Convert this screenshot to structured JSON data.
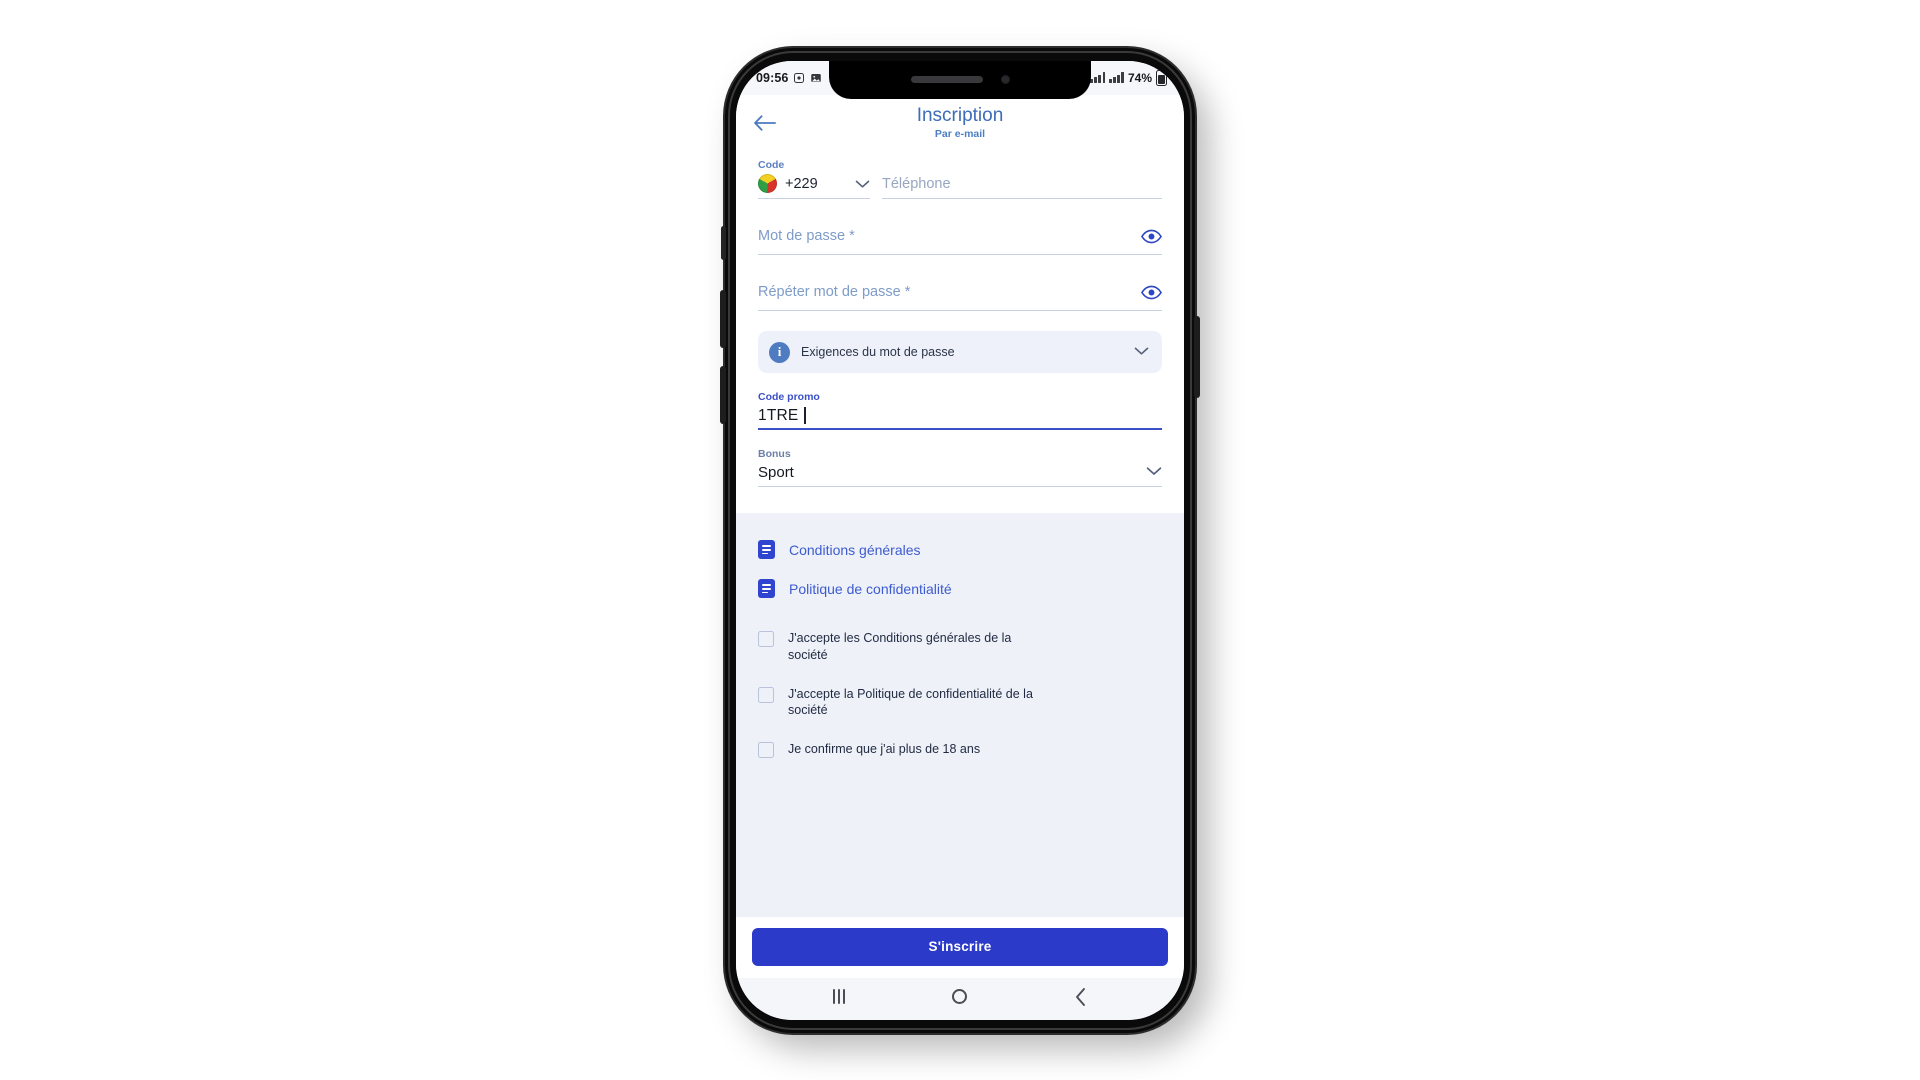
{
  "status_bar": {
    "time": "09:56",
    "alarm_icon": "alarm-icon",
    "picture_icon": "picture-icon",
    "signal_icon": "signal-bars-icon",
    "battery_percent": "74%",
    "battery_icon": "battery-icon"
  },
  "header": {
    "back_icon": "back-arrow-icon",
    "title": "Inscription",
    "subtitle": "Par e-mail"
  },
  "form": {
    "country_code": {
      "label": "Code",
      "flag_icon": "benin-flag-icon",
      "value": "+229",
      "chevron_icon": "chevron-down-icon"
    },
    "phone": {
      "placeholder": "Téléphone",
      "value": ""
    },
    "password": {
      "placeholder": "Mot de passe *",
      "value": "",
      "toggle_icon": "eye-icon"
    },
    "password_repeat": {
      "placeholder": "Répéter mot de passe *",
      "value": "",
      "toggle_icon": "eye-icon"
    },
    "password_requirements": {
      "info_icon": "info-icon",
      "label": "Exigences du mot de passe",
      "chevron_icon": "chevron-down-icon"
    },
    "promo_code": {
      "label": "Code promo",
      "value": "1TRE"
    },
    "bonus": {
      "label": "Bonus",
      "value": "Sport",
      "chevron_icon": "chevron-down-icon"
    }
  },
  "links": [
    {
      "icon": "document-icon",
      "label": "Conditions générales"
    },
    {
      "icon": "document-icon",
      "label": "Politique de confidentialité"
    }
  ],
  "checkboxes": [
    {
      "label": "J'accepte les Conditions générales de la société",
      "checked": false
    },
    {
      "label": "J'accepte la Politique de confidentialité de la société",
      "checked": false
    },
    {
      "label": "Je confirme que j'ai plus de 18 ans",
      "checked": false
    }
  ],
  "submit": {
    "label": "S'inscrire"
  },
  "nav_bar": {
    "recents_icon": "recents-icon",
    "home_icon": "home-icon",
    "back_icon": "back-icon"
  },
  "colors": {
    "accent_blue": "#2b3ac9",
    "title_blue": "#3d6cb9",
    "link_blue": "#3d5bd0",
    "page_bg": "#eef1f8"
  }
}
